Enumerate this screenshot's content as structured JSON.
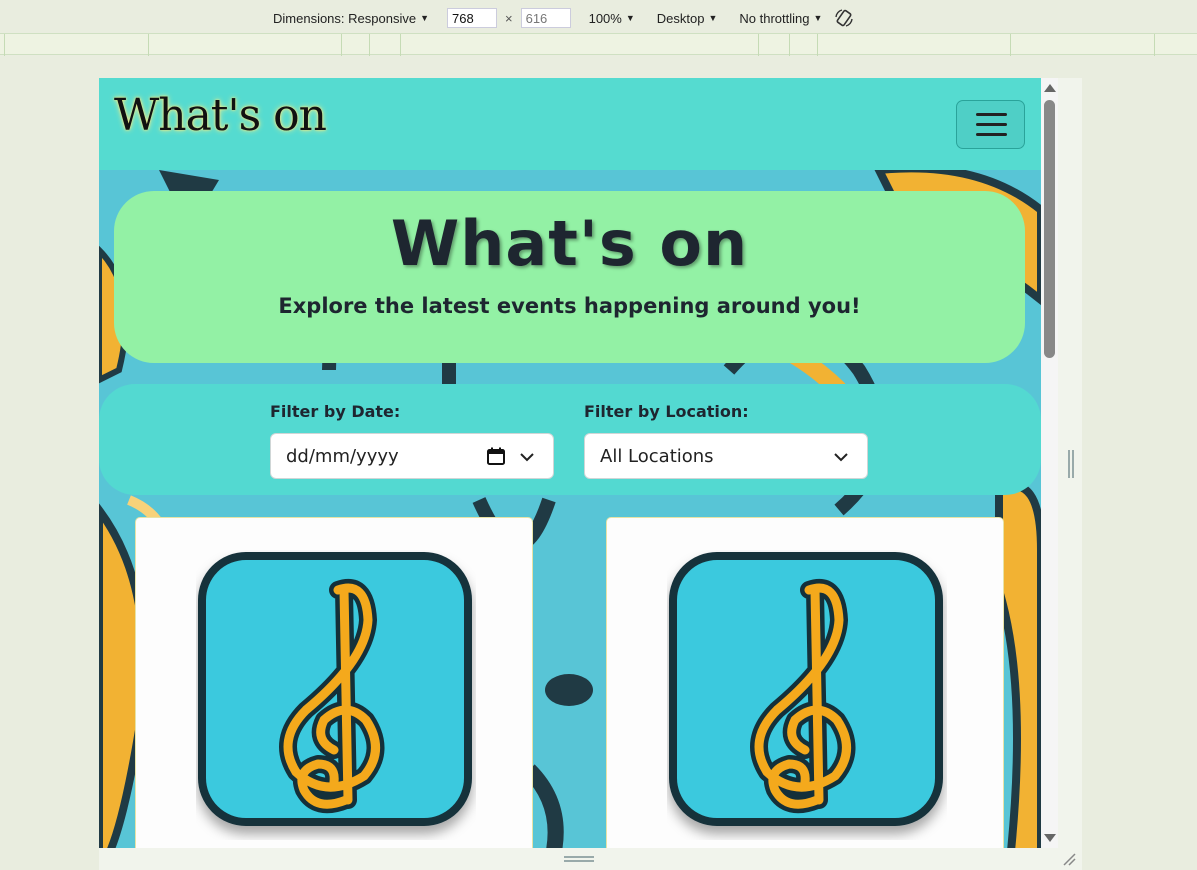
{
  "devtools": {
    "dimensions_label": "Dimensions: Responsive",
    "width_value": "768",
    "height_value": "616",
    "zoom": "100%",
    "device": "Desktop",
    "throttling": "No throttling"
  },
  "navbar": {
    "brand": "What's on"
  },
  "hero": {
    "title": "What's on",
    "subtitle": "Explore the latest events happening around you!"
  },
  "filters": {
    "date_label": "Filter by Date:",
    "date_placeholder": "dd/mm/yyyy",
    "location_label": "Filter by Location:",
    "location_selected": "All Locations"
  },
  "cards": [
    {
      "image": "treble-clef-icon"
    },
    {
      "image": "treble-clef-icon"
    }
  ],
  "colors": {
    "navbar": "#55dbd0",
    "hero": "#93f1a5",
    "filters": "#53d9d1",
    "icon_tile": "#3bc9de",
    "clef": "#f4a91c"
  }
}
